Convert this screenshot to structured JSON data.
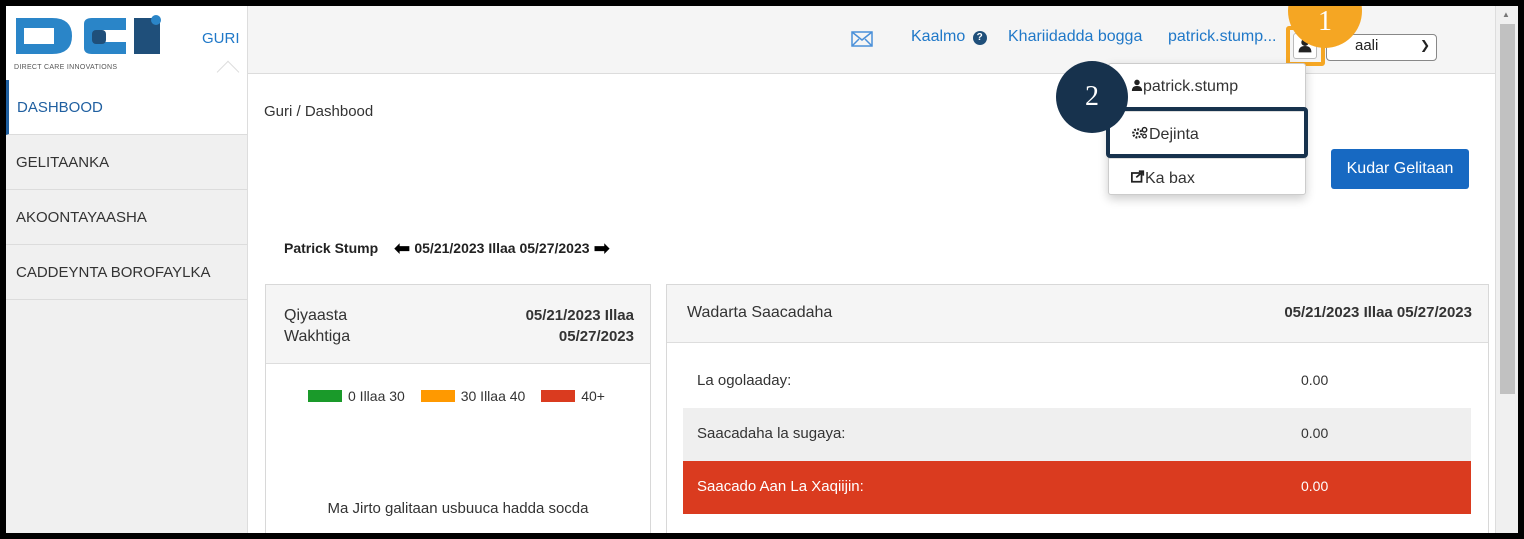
{
  "header": {
    "logo_caption": "DIRECT CARE INNOVATIONS",
    "logo_letters": "DCI",
    "home_link": "GURI",
    "help_link": "Kaalmo",
    "shop_link": "Khariidadda bogga",
    "username": "patrick.stump...",
    "language_select": "aali"
  },
  "sidebar": {
    "items": [
      {
        "label": "DASHBOOD",
        "active": true
      },
      {
        "label": "GELITAANKA"
      },
      {
        "label": "AKOONTAYAASHA"
      },
      {
        "label": "CADDEYNTA BOROFAYLKA"
      }
    ]
  },
  "main": {
    "breadcrumb": "Guri / Dashbood",
    "add_entry_button": "Kudar Gelitaan",
    "week_nav": {
      "name": "Patrick Stump",
      "range": "05/21/2023 Illaa 05/27/2023"
    },
    "estimate_panel": {
      "title": "Qiyaasta Wakhtiga",
      "date_range": "05/21/2023 Illaa 05/27/2023",
      "legend": [
        {
          "label": "0 Illaa 30",
          "color": "#1a9a2a"
        },
        {
          "label": "30 Illaa 40",
          "color": "#ff9900"
        },
        {
          "label": "40+",
          "color": "#da3b1f"
        }
      ],
      "message": "Ma Jirto galitaan usbuuca hadda socda"
    },
    "summary_panel": {
      "title": "Wadarta Saacadaha",
      "date_range": "05/21/2023 Illaa 05/27/2023",
      "rows": [
        {
          "label": "La ogolaaday:",
          "value": "0.00"
        },
        {
          "label": "Saacadaha la sugaya:",
          "value": "0.00"
        },
        {
          "label": "Saacado Aan La Xaqiijin:",
          "value": "0.00"
        }
      ]
    }
  },
  "user_menu": {
    "items": [
      {
        "label": "patrick.stump",
        "icon": "user-icon"
      },
      {
        "label": "Dejinta",
        "icon": "gears-icon"
      },
      {
        "label": "Ka bax",
        "icon": "share-out-icon"
      }
    ]
  },
  "callouts": {
    "step1": "1",
    "step2": "2"
  },
  "colors": {
    "accent": "#1769c2",
    "highlight_orange": "#f5a623",
    "highlight_navy": "#17324d",
    "danger": "#da3b1f"
  }
}
